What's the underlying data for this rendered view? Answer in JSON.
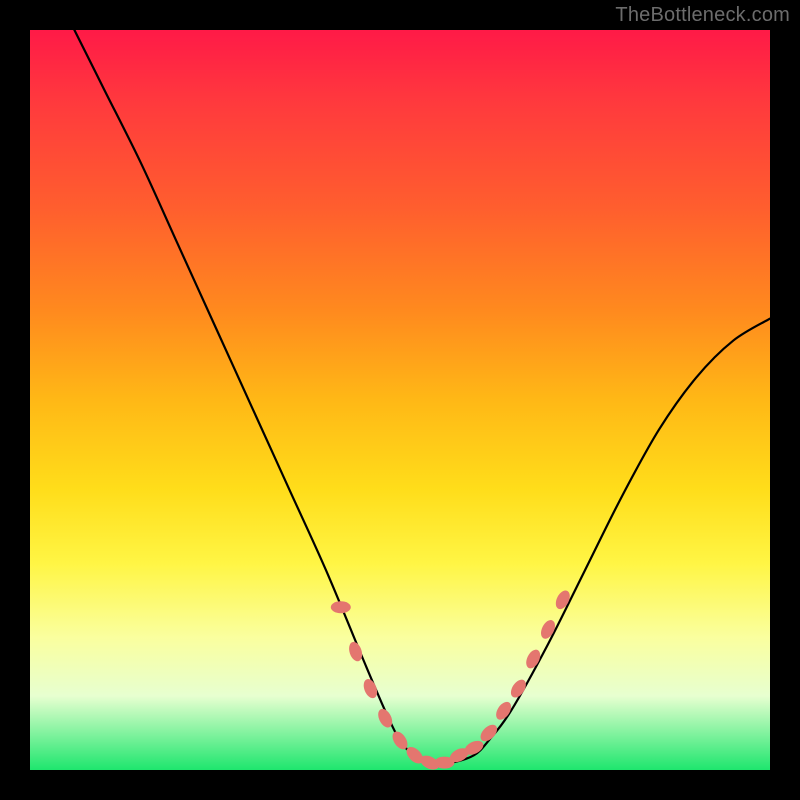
{
  "watermark": "TheBottleneck.com",
  "chart_data": {
    "type": "line",
    "title": "",
    "xlabel": "",
    "ylabel": "",
    "xlim": [
      0,
      100
    ],
    "ylim": [
      0,
      100
    ],
    "series": [
      {
        "name": "curve",
        "x": [
          6,
          10,
          15,
          20,
          25,
          30,
          35,
          40,
          45,
          48,
          50,
          52,
          55,
          57,
          60,
          62,
          65,
          70,
          75,
          80,
          85,
          90,
          95,
          100
        ],
        "y": [
          100,
          92,
          82,
          71,
          60,
          49,
          38,
          27,
          15,
          8,
          4,
          2,
          1,
          1,
          2,
          4,
          8,
          17,
          27,
          37,
          46,
          53,
          58,
          61
        ]
      }
    ],
    "markers": {
      "name": "highlight-points",
      "color": "#e4766f",
      "x": [
        42,
        44,
        46,
        48,
        50,
        52,
        54,
        56,
        58,
        60,
        62,
        64,
        66,
        68,
        70,
        72
      ],
      "y": [
        22,
        16,
        11,
        7,
        4,
        2,
        1,
        1,
        2,
        3,
        5,
        8,
        11,
        15,
        19,
        23
      ]
    },
    "gradient_stops": [
      {
        "pos": 0,
        "color": "#ff1a47"
      },
      {
        "pos": 10,
        "color": "#ff3a3d"
      },
      {
        "pos": 24,
        "color": "#ff5e2e"
      },
      {
        "pos": 38,
        "color": "#ff8a1e"
      },
      {
        "pos": 50,
        "color": "#ffb816"
      },
      {
        "pos": 62,
        "color": "#ffdd1a"
      },
      {
        "pos": 72,
        "color": "#fff544"
      },
      {
        "pos": 82,
        "color": "#faff9e"
      },
      {
        "pos": 90,
        "color": "#e7ffd0"
      },
      {
        "pos": 100,
        "color": "#1ee66e"
      }
    ]
  }
}
